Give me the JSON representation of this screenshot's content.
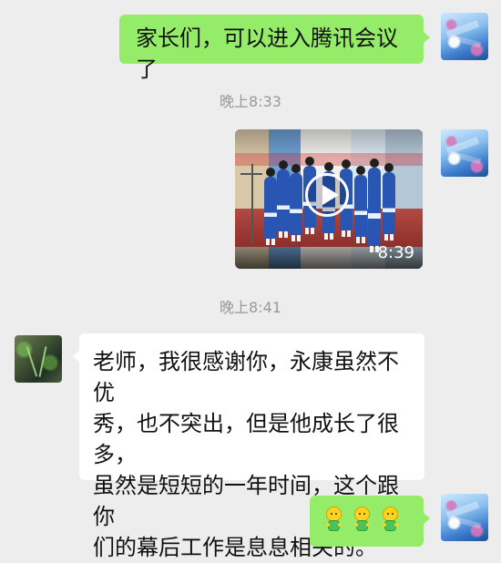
{
  "messages": [
    {
      "text": "家长们，可以进入腾讯会议了"
    },
    {
      "video_duration": "8:39"
    },
    {
      "text": "老师，我很感谢你，永康虽然不优\n秀，也不突出，但是他成长了很多，\n虽然是短短的一年时间，这个跟你\n们的幕后工作是息息相关的。"
    },
    {
      "emoji_names": [
        "clapping-emoji-icon",
        "clapping-emoji-icon",
        "clapping-emoji-icon"
      ]
    }
  ],
  "timestamps": [
    "晚上8:33",
    "晚上8:41"
  ],
  "colors": {
    "background": "#ededed",
    "outgoing_bubble": "#95ec69",
    "incoming_bubble": "#ffffff",
    "timestamp": "#999999"
  }
}
